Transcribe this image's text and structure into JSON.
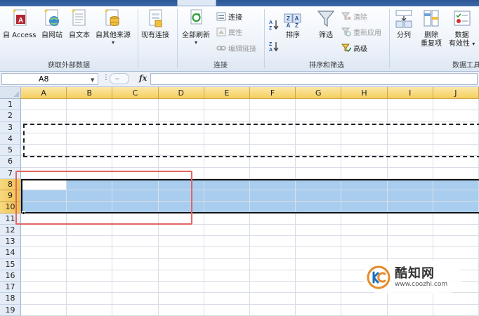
{
  "ribbon": {
    "get_external": {
      "from_access": "自 Access",
      "from_web": "自网站",
      "from_text": "自文本",
      "from_other": "自其他来源",
      "group_label": "获取外部数据"
    },
    "existing_connections": "现有连接",
    "connections": {
      "refresh_all": "全部刷新",
      "connections": "连接",
      "properties": "属性",
      "edit_links": "编辑链接",
      "group_label": "连接"
    },
    "sort_filter": {
      "sort": "排序",
      "filter": "筛选",
      "clear": "清除",
      "reapply": "重新应用",
      "advanced": "高级",
      "group_label": "排序和筛选"
    },
    "data_tools": {
      "text_to_columns": "分列",
      "remove_duplicates_l1": "删除",
      "remove_duplicates_l2": "重复项",
      "validation_l1": "数据",
      "validation_l2": "有效性",
      "group_label": "数据工具"
    }
  },
  "formula_bar": {
    "name_box": "A8",
    "fx": "fx",
    "formula": ""
  },
  "columns": [
    "A",
    "B",
    "C",
    "D",
    "E",
    "F",
    "G",
    "H",
    "I",
    "J"
  ],
  "rows": [
    "1",
    "2",
    "3",
    "4",
    "5",
    "6",
    "7",
    "8",
    "9",
    "10",
    "11",
    "12",
    "13",
    "14",
    "15",
    "16",
    "17",
    "18",
    "19"
  ],
  "selected_rows": [
    "8",
    "9",
    "10"
  ],
  "active_cell": "A8",
  "copied_rows": [
    "3",
    "4",
    "5"
  ],
  "watermark": {
    "name": "酷知网",
    "url": "www.coozhi.com"
  },
  "colors": {
    "selection": "#a9cdee",
    "header_selected": "#f5cf5d",
    "annotation_box": "#e06666"
  }
}
